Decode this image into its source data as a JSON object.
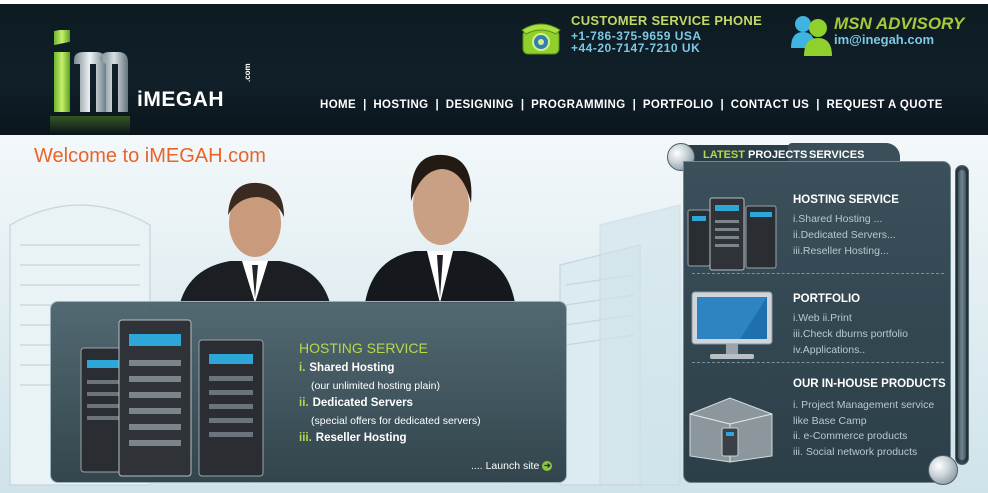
{
  "header": {
    "logo_text": "iMEGAH",
    "logo_suffix": ".com",
    "phone": {
      "title": "CUSTOMER SERVICE PHONE",
      "line1": "+1-786-375-9659  USA",
      "line2": "+44-20-7147-7210  UK"
    },
    "msn": {
      "title": "MSN ADVISORY",
      "email": "im@inegah.com"
    },
    "nav": [
      "HOME",
      "HOSTING",
      "DESIGNING",
      "PROGRAMMING",
      "PORTFOLIO",
      "CONTACT US",
      "REQUEST  A QUOTE"
    ]
  },
  "hero": {
    "welcome": "Welcome to iMEGAH.com",
    "hosting": {
      "title": "HOSTING SERVICE",
      "items": [
        {
          "num": "i.",
          "label": "Shared Hosting",
          "sub": "(our unlimited hosting plain)"
        },
        {
          "num": "ii.",
          "label": "Dedicated Servers",
          "sub": "(special offers for dedicated servers)"
        },
        {
          "num": "iii.",
          "label": "Reseller Hosting",
          "sub": ""
        }
      ],
      "launch": ".... Launch site"
    }
  },
  "projects": {
    "tab_latest_hl": "LATEST",
    "tab_latest_rest": " PROJECTS",
    "tab_services": "SERVICES",
    "sections": [
      {
        "title": "HOSTING SERVICE",
        "lines": [
          "i.Shared Hosting ...",
          "ii.Dedicated Servers...",
          "iii.Reseller Hosting..."
        ]
      },
      {
        "title": "PORTFOLIO",
        "lines": [
          "i.Web    ii.Print",
          "iii.Check dburns portfolio",
          "iv.Applications.."
        ]
      },
      {
        "title": "OUR IN-HOUSE PRODUCTS",
        "lines": [
          "i. Project Management service",
          "   like Base Camp",
          "ii. e-Commerce products",
          "iii. Social network products"
        ]
      }
    ]
  },
  "colors": {
    "accent_green": "#b6d94a",
    "accent_orange": "#e8652a",
    "header_bg": "#102029",
    "panel_bg": "#2c3f49"
  },
  "icons": [
    "phone-icon",
    "msn-buddy-icon",
    "server-icon",
    "monitor-icon",
    "product-box-icon",
    "arrow-right-icon"
  ]
}
